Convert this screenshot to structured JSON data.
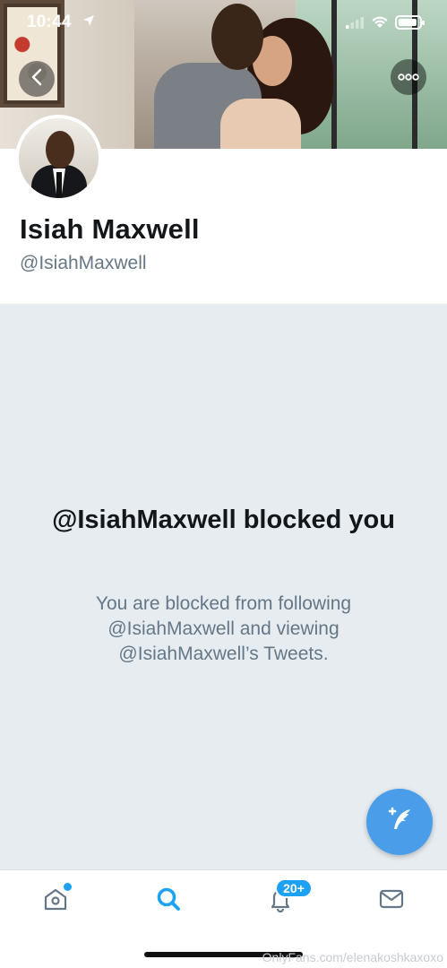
{
  "status_bar": {
    "time": "10:44"
  },
  "profile": {
    "name": "Isiah Maxwell",
    "handle": "@IsiahMaxwell"
  },
  "blocked": {
    "title": "@IsiahMaxwell blocked you",
    "description": "You are blocked from following @IsiahMaxwell and viewing @IsiahMaxwell’s Tweets."
  },
  "tabbar": {
    "notifications_badge": "20+",
    "icons": [
      "home-icon",
      "search-icon",
      "bell-icon",
      "mail-icon"
    ]
  },
  "watermark": "OnlyFans.com/elenakoshkaxoxo",
  "colors": {
    "accent": "#1da1f2",
    "fab": "#4a9ee9",
    "blocked_bg": "#e6ecf0",
    "secondary_text": "#657786"
  }
}
